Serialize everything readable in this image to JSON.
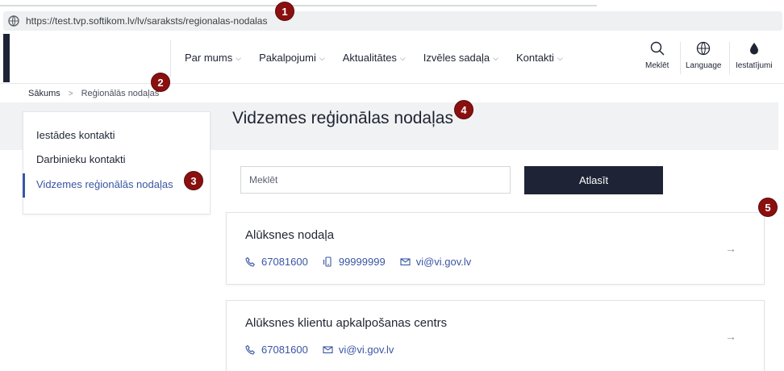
{
  "browser": {
    "url": "https://test.tvp.softikom.lv/lv/saraksts/regionalas-nodalas"
  },
  "nav": {
    "items": [
      {
        "label": "Par mums"
      },
      {
        "label": "Pakalpojumi"
      },
      {
        "label": "Aktualitātes"
      },
      {
        "label": "Izvēles sadaļa"
      },
      {
        "label": "Kontakti"
      }
    ]
  },
  "tools": {
    "search_label": "Meklēt",
    "language_label": "Language",
    "settings_label": "Iestatījumi"
  },
  "breadcrumb": {
    "home": "Sākums",
    "separator": ">",
    "current": "Reģionālās nodaļas"
  },
  "sidebar": {
    "items": [
      {
        "label": "Iestādes kontakti"
      },
      {
        "label": "Darbinieku kontakti"
      },
      {
        "label": "Vidzemes reģionālās nodaļas"
      }
    ]
  },
  "page": {
    "title": "Vidzemes reģionālas nodaļas"
  },
  "search": {
    "placeholder": "Meklēt",
    "button_label": "Atlasīt"
  },
  "cards": [
    {
      "title": "Alūksnes nodaļa",
      "phone": "67081600",
      "mobile": "99999999",
      "email": "vi@vi.gov.lv",
      "arrow": "→"
    },
    {
      "title": "Alūksnes klientu apkalpošanas centrs",
      "phone": "67081600",
      "email": "vi@vi.gov.lv",
      "arrow": "→"
    }
  ],
  "markers": [
    "1",
    "2",
    "3",
    "4",
    "5"
  ],
  "colors": {
    "dark": "#1e2436",
    "accent": "#3a55a4",
    "marker": "#8a1010"
  },
  "icons": {
    "address": "globe-icon",
    "search": "magnifier-icon",
    "language": "globe-icon",
    "settings": "droplet-icon",
    "phone": "phone-icon",
    "mobile": "mobile-phone-icon",
    "email": "envelope-icon",
    "chevron": "chevron-down-icon"
  }
}
